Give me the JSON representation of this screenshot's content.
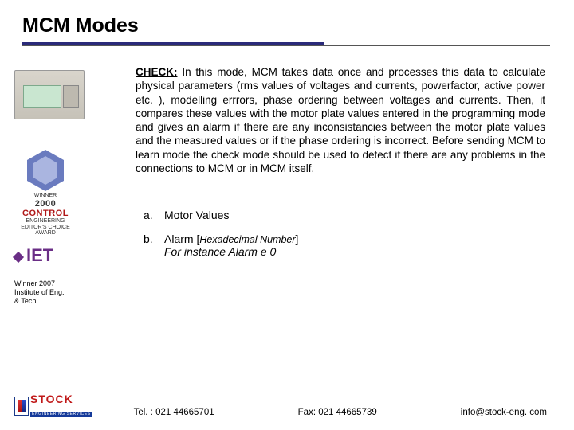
{
  "title": "MCM Modes",
  "check": {
    "label": "CHECK:",
    "body": " In this mode, MCM takes data once and processes this data to calculate physical parameters (rms values of voltages and currents, powerfactor, active power etc. ), modelling errrors, phase ordering between voltages and currents. Then, it compares these values with the motor plate values entered in the programming mode and gives an alarm if there are any inconsistancies between the motor plate values and the measured values or if the phase ordering is incorrect. Before sending MCM to learn mode the check mode should be used to detect if there are any problems in the connections to MCM or  in MCM itself."
  },
  "list": {
    "a": {
      "letter": "a.",
      "text": "Motor Values"
    },
    "b": {
      "letter": "b.",
      "lead": "Alarm [",
      "hex": "Hexadecimal Number",
      "close": "]",
      "example": "For instance Alarm e 0"
    }
  },
  "sidebar": {
    "award": {
      "winner": "WINNER",
      "year": "2000",
      "mag": "CONTROL",
      "sub": "ENGINEERING",
      "choice": "EDITOR'S CHOICE AWARD"
    },
    "iet": {
      "letters": "IET"
    },
    "winner": {
      "l1": "Winner 2007",
      "l2": "Institute of Eng.",
      "l3": "& Tech."
    }
  },
  "footer": {
    "brand": "STOCK",
    "brand_sub": "ENGINEERING SERVICES",
    "tel": "Tel. : 021 44665701",
    "fax": "Fax: 021 44665739",
    "email": "info@stock-eng. com"
  }
}
